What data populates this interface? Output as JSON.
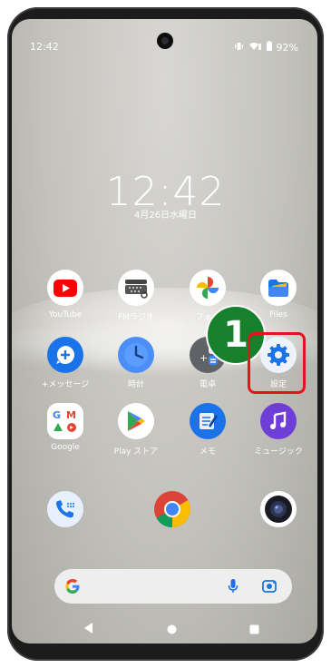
{
  "status": {
    "time": "12:42",
    "battery": "92%"
  },
  "clock": {
    "time": "12:42",
    "date": "4月26日水曜日"
  },
  "apps": {
    "youtube": "YouTube",
    "fm_radio": "FMラジオ",
    "photos": "フォト",
    "files": "Files",
    "messages": "+メッセージ",
    "clock": "時計",
    "calculator": "電卓",
    "settings": "設定",
    "google": "Google",
    "play_store": "Play ストア",
    "memo": "メモ",
    "music": "ミュージック"
  },
  "annotation": {
    "step": "1"
  },
  "colors": {
    "highlight": "#e5141b",
    "badge": "#17802d"
  }
}
